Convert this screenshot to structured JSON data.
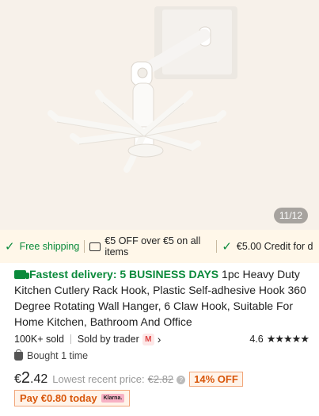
{
  "gallery": {
    "counter": "11/12"
  },
  "benefits": {
    "free_shipping": "Free shipping",
    "coupon": "€5 OFF over €5 on all items",
    "credit": "€5.00 Credit for d"
  },
  "product": {
    "fast_delivery": "Fastest delivery: 5 BUSINESS DAYS",
    "title": " 1pc Heavy Duty Kitchen Cutlery Rack Hook, Plastic Self-adhesive Hook 360 Degree Rotating Wall Hanger, 6 Claw Hook, Suitable For Home Kitchen, Bathroom And Office"
  },
  "meta": {
    "sold": "100K+ sold",
    "sold_by": "Sold by trader",
    "trader_badge": "M",
    "rating": "4.6",
    "stars": "★★★★★",
    "bought": "Bought 1 time"
  },
  "pricing": {
    "currency": "€",
    "price_int": "2",
    "price_dec": ".42",
    "lowest_label": "Lowest recent price:",
    "lowest_value": "€2.82",
    "discount": "14% OFF",
    "pay_today": "Pay €0.80 today",
    "klarna": "Klarna."
  },
  "colors": {
    "green": "#0a8a3b",
    "orange": "#d8560a",
    "hero_bg": "#f7f1ea",
    "benefit_bg": "#fff7e9"
  }
}
